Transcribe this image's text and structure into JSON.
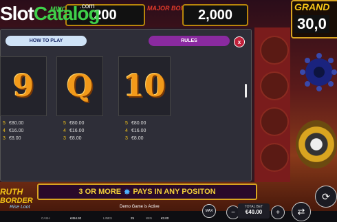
{
  "watermark": {
    "brand": "Slot",
    "brand_accent": "Catalog",
    "suffix": ".com"
  },
  "jackpots": {
    "mini_label": "MINOR",
    "mini_value": "200",
    "major_label": "MAJOR BONUS",
    "major_value": "2,000",
    "grand_label": "GRAND",
    "grand_value": "30,0"
  },
  "panel": {
    "tab_howto": "HOW TO PLAY",
    "tab_rules": "RULES",
    "close_glyph": "x",
    "symbols": [
      {
        "glyph": "9",
        "pays": [
          {
            "count": "5",
            "amount": "€80.00"
          },
          {
            "count": "4",
            "amount": "€16.00"
          },
          {
            "count": "3",
            "amount": "€8.00"
          }
        ]
      },
      {
        "glyph": "Q",
        "pays": [
          {
            "count": "5",
            "amount": "€80.00"
          },
          {
            "count": "4",
            "amount": "€16.00"
          },
          {
            "count": "3",
            "amount": "€8.00"
          }
        ]
      },
      {
        "glyph": "10",
        "pays": [
          {
            "count": "5",
            "amount": "€80.00"
          },
          {
            "count": "4",
            "amount": "€16.00"
          },
          {
            "count": "3",
            "amount": "€8.00"
          }
        ]
      }
    ]
  },
  "banner": {
    "left": "3 OR MORE",
    "right": "PAYS IN ANY POSITON"
  },
  "game_logo": {
    "line1": "RUTH",
    "line2": "BORDER",
    "line3": "Rise Loot"
  },
  "bottom": {
    "status": "Demo Game is Active",
    "cash_label": "CASH",
    "cash_value": "€454.92",
    "lines_label": "LINES",
    "lines_value": "25",
    "win_label": "WIN",
    "win_value": "€3.00",
    "max_label": "MAX",
    "total_bet_label": "TOTAL BET",
    "total_bet_value": "€40.00"
  },
  "colors": {
    "accent_gold": "#d9a520",
    "rules_tab": "#8a2aa0",
    "howto_tab": "#cfe3f7",
    "close": "#c0203a"
  }
}
